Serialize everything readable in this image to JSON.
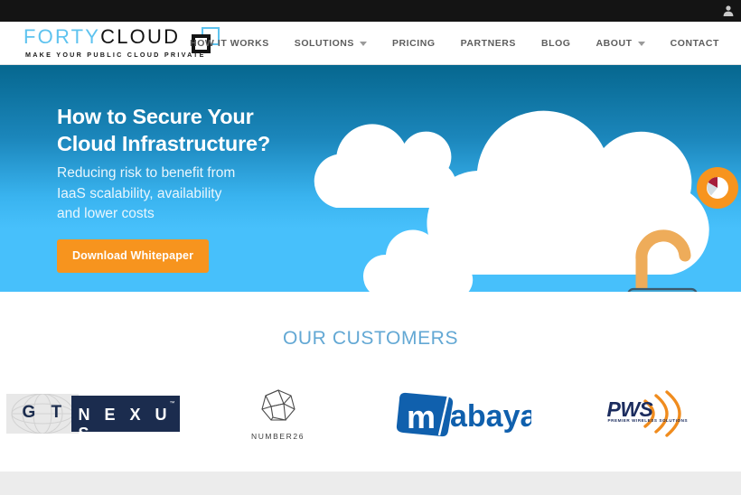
{
  "topbar": {
    "user_icon": "user-icon"
  },
  "header": {
    "logo": {
      "word_1": "FORTY",
      "word_2": "CLOUD",
      "tagline": "MAKE YOUR PUBLIC CLOUD PRIVATE",
      "color_accent": "#5ec3ef",
      "color_dark": "#141414"
    },
    "nav": [
      {
        "label": "HOW IT WORKS",
        "has_dropdown": false
      },
      {
        "label": "SOLUTIONS",
        "has_dropdown": true
      },
      {
        "label": "PRICING",
        "has_dropdown": false
      },
      {
        "label": "PARTNERS",
        "has_dropdown": false
      },
      {
        "label": "BLOG",
        "has_dropdown": false
      },
      {
        "label": "ABOUT",
        "has_dropdown": true
      },
      {
        "label": "CONTACT",
        "has_dropdown": false
      }
    ]
  },
  "hero": {
    "title_line_1": "How to Secure Your",
    "title_line_2": "Cloud Infrastructure?",
    "sub_line_1": "Reducing risk to benefit from",
    "sub_line_2": "IaaS scalability, availability",
    "sub_line_3": "and lower costs",
    "cta_label": "Download Whitepaper",
    "cta_color": "#f7941e",
    "sky_top_color": "#06678f",
    "sky_bottom_color": "#47c0fb",
    "lock_body_color": "#3fa9d8",
    "lock_shackle_color": "#f5b25e",
    "badge_icon": "pie-chart-icon",
    "badge_color": "#f7941e"
  },
  "customers": {
    "title": "OUR CUSTOMERS",
    "title_color": "#63a8d4",
    "logos": [
      {
        "name": "GT NEXUS",
        "part_1": "G T",
        "part_2": "N E X U S",
        "trademark": "™",
        "color": "#1b2c4e"
      },
      {
        "name": "NUMBER26",
        "wordmark": "NUMBER26",
        "color": "#3d3d3d"
      },
      {
        "name": "Mabaya",
        "wordmark": "abaya",
        "mark_letter": "m",
        "color": "#1060ad"
      },
      {
        "name": "PWS",
        "wordmark": "PWS",
        "tagline": "PREMIER WIRELESS SOLUTIONS",
        "color": "#1b2c5e",
        "accent": "#f08c1e"
      }
    ]
  },
  "footer": {
    "band_color": "#ececec"
  }
}
